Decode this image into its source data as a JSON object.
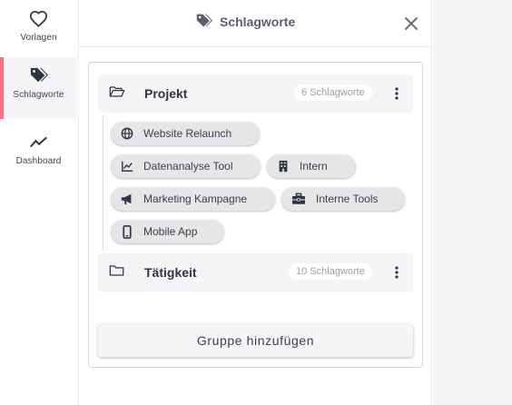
{
  "nav": {
    "items": [
      {
        "label": "Vorlagen",
        "icon": "heart-icon"
      },
      {
        "label": "Schlagworte",
        "icon": "tag-icon",
        "active": true
      },
      {
        "label": "Dashboard",
        "icon": "trend-line-icon"
      }
    ],
    "active_indicator_color": "#f07383"
  },
  "panel": {
    "title": "Schlagworte",
    "title_icon": "tag-icon",
    "close_icon": "close-icon"
  },
  "groups": [
    {
      "name": "Projekt",
      "count_label": "6 Schlagworte",
      "expanded": true,
      "tags": [
        {
          "label": "Website Relaunch",
          "icon": "globe-icon"
        },
        {
          "label": "Datenanalyse Tool",
          "icon": "chart-line-icon"
        },
        {
          "label": "Intern",
          "icon": "building-icon"
        },
        {
          "label": "Marketing Kampagne",
          "icon": "megaphone-icon"
        },
        {
          "label": "Interne Tools",
          "icon": "toolbox-icon"
        },
        {
          "label": "Mobile App",
          "icon": "mobile-icon"
        }
      ]
    },
    {
      "name": "Tätigkeit",
      "count_label": "10 Schlagworte",
      "expanded": false,
      "tags": []
    }
  ],
  "actions": {
    "add_group_label": "Gruppe hinzufügen"
  }
}
